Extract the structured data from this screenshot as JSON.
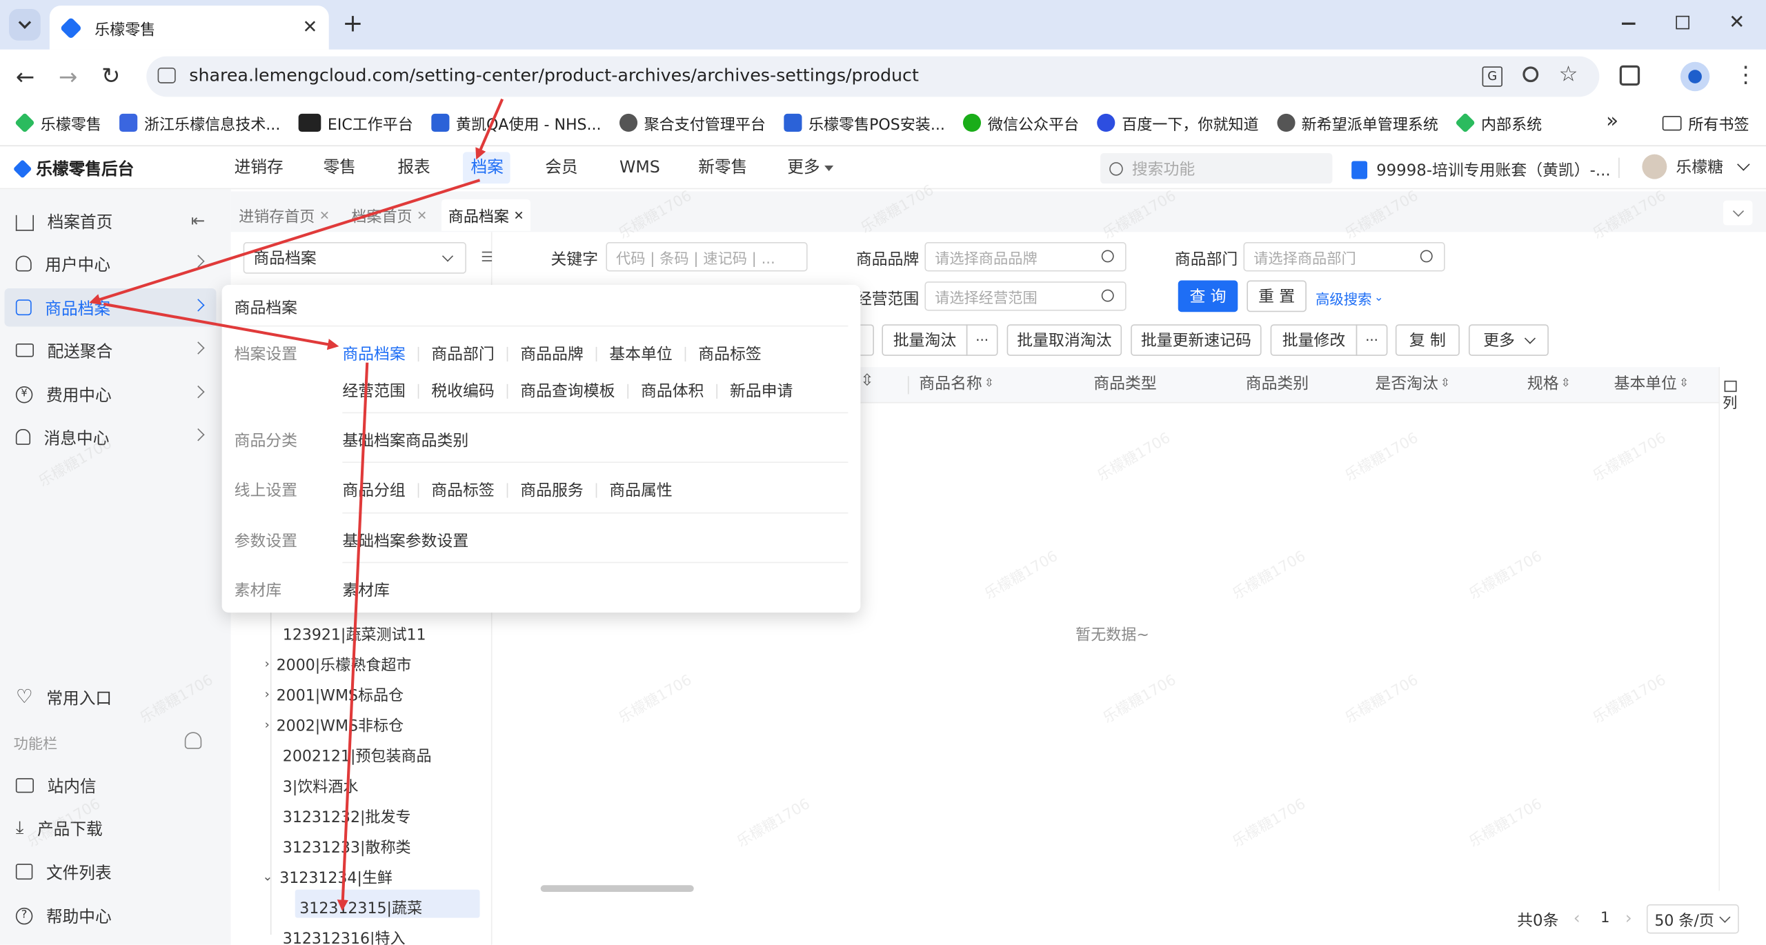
{
  "browser": {
    "tab_title": "乐檬零售",
    "url": "sharea.lemengcloud.com/setting-center/product-archives/archives-settings/product",
    "bookmarks": [
      "乐檬零售",
      "浙江乐檬信息技术...",
      "EIC工作平台",
      "黄凯QA使用 - NHS...",
      "聚合支付管理平台",
      "乐檬零售POS安装...",
      "微信公众平台",
      "百度一下，你就知道",
      "新希望派单管理系统",
      "内部系统"
    ],
    "all_bookmarks": "所有书签",
    "overflow": "»"
  },
  "app": {
    "logo": "乐檬零售后台",
    "nav": [
      "进销存",
      "零售",
      "报表",
      "档案",
      "会员",
      "WMS",
      "新零售",
      "更多"
    ],
    "search_placeholder": "搜索功能",
    "account": "99998-培训专用账套（黄凯）-...",
    "user": "乐檬糖"
  },
  "sidebar": {
    "items": [
      "档案首页",
      "用户中心",
      "商品档案",
      "配送聚合",
      "费用中心",
      "消息中心"
    ],
    "common": "常用入口",
    "toolbar_label": "功能栏",
    "tools": [
      "站内信",
      "产品下载",
      "文件列表",
      "帮助中心"
    ]
  },
  "page_tabs": [
    "进销存首页",
    "档案首页",
    "商品档案"
  ],
  "tree": {
    "select_value": "商品档案",
    "nodes": [
      "123921|蔬菜测试11",
      "2000|乐檬熟食超市",
      "2001|WMS标品仓",
      "2002|WMS非标仓",
      "2002121|预包装商品",
      "3|饮料酒水",
      "31231232|批发专",
      "31231233|散称类",
      "31231234|生鲜",
      "312312315|蔬菜",
      "312312316|特入"
    ]
  },
  "filters": {
    "keyword_label": "关键字",
    "keyword_placeholder": "代码 | 条码 | 速记码 | ...",
    "brand_label": "商品品牌",
    "brand_placeholder": "请选择商品品牌",
    "dept_label": "商品部门",
    "dept_placeholder": "请选择商品部门",
    "scope_label": "经营范围",
    "scope_placeholder": "请选择经营范围",
    "query": "查 询",
    "reset": "重 置",
    "advanced": "高级搜索"
  },
  "actions": [
    "批量淘汰",
    "批量取消淘汰",
    "批量更新速记码",
    "批量修改",
    "复 制",
    "更多"
  ],
  "more_dots": "···",
  "table": {
    "columns": [
      "商品名称",
      "商品类型",
      "商品类别",
      "是否淘汰",
      "规格",
      "基本单位"
    ],
    "empty": "暂无数据~",
    "col_setting": "列"
  },
  "pagination": {
    "total": "共0条",
    "page": "1",
    "page_size": "50 条/页"
  },
  "dropdown": {
    "title": "商品档案",
    "sections": [
      {
        "label": "档案设置",
        "rows": [
          [
            "商品档案",
            "商品部门",
            "商品品牌",
            "基本单位",
            "商品标签"
          ],
          [
            "经营范围",
            "税收编码",
            "商品查询模板",
            "商品体积",
            "新品申请"
          ]
        ]
      },
      {
        "label": "商品分类",
        "rows": [
          [
            "基础档案商品类别"
          ]
        ]
      },
      {
        "label": "线上设置",
        "rows": [
          [
            "商品分组",
            "商品标签",
            "商品服务",
            "商品属性"
          ]
        ]
      },
      {
        "label": "参数设置",
        "rows": [
          [
            "基础档案参数设置"
          ]
        ]
      },
      {
        "label": "素材库",
        "rows": [
          [
            "素材库"
          ]
        ]
      }
    ]
  },
  "watermark": "乐檬糖1706",
  "colors": {
    "accent": "#1e6ef5",
    "annotation": "#e03a3a",
    "sidebar_bg": "#f5f6f8"
  }
}
